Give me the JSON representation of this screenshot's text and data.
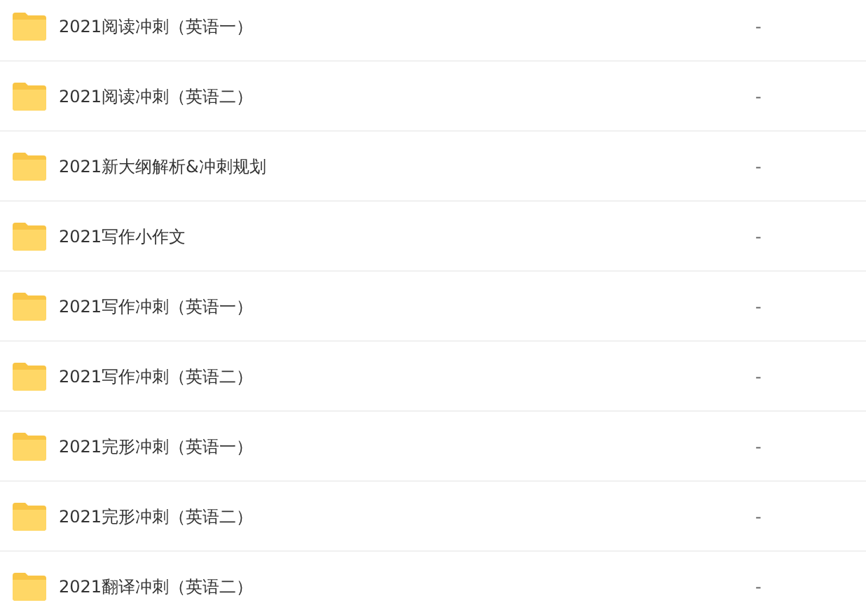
{
  "files": [
    {
      "name": "2021阅读冲刺（英语一）",
      "size": "-"
    },
    {
      "name": "2021阅读冲刺（英语二）",
      "size": "-"
    },
    {
      "name": "2021新大纲解析&冲刺规划",
      "size": "-"
    },
    {
      "name": "2021写作小作文",
      "size": "-"
    },
    {
      "name": "2021写作冲刺（英语一）",
      "size": "-"
    },
    {
      "name": "2021写作冲刺（英语二）",
      "size": "-"
    },
    {
      "name": "2021完形冲刺（英语一）",
      "size": "-"
    },
    {
      "name": "2021完形冲刺（英语二）",
      "size": "-"
    },
    {
      "name": "2021翻译冲刺（英语二）",
      "size": "-"
    }
  ]
}
